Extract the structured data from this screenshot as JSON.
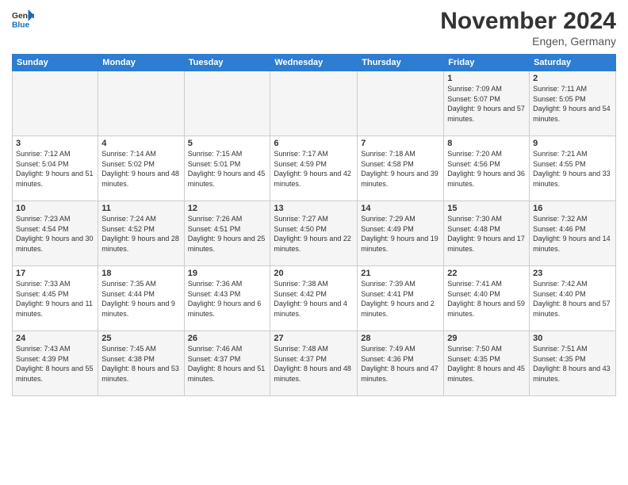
{
  "logo": {
    "general": "General",
    "blue": "Blue"
  },
  "header": {
    "title": "November 2024",
    "location": "Engen, Germany"
  },
  "days_of_week": [
    "Sunday",
    "Monday",
    "Tuesday",
    "Wednesday",
    "Thursday",
    "Friday",
    "Saturday"
  ],
  "weeks": [
    [
      {
        "day": "",
        "details": ""
      },
      {
        "day": "",
        "details": ""
      },
      {
        "day": "",
        "details": ""
      },
      {
        "day": "",
        "details": ""
      },
      {
        "day": "",
        "details": ""
      },
      {
        "day": "1",
        "details": "Sunrise: 7:09 AM\nSunset: 5:07 PM\nDaylight: 9 hours and 57 minutes."
      },
      {
        "day": "2",
        "details": "Sunrise: 7:11 AM\nSunset: 5:05 PM\nDaylight: 9 hours and 54 minutes."
      }
    ],
    [
      {
        "day": "3",
        "details": "Sunrise: 7:12 AM\nSunset: 5:04 PM\nDaylight: 9 hours and 51 minutes."
      },
      {
        "day": "4",
        "details": "Sunrise: 7:14 AM\nSunset: 5:02 PM\nDaylight: 9 hours and 48 minutes."
      },
      {
        "day": "5",
        "details": "Sunrise: 7:15 AM\nSunset: 5:01 PM\nDaylight: 9 hours and 45 minutes."
      },
      {
        "day": "6",
        "details": "Sunrise: 7:17 AM\nSunset: 4:59 PM\nDaylight: 9 hours and 42 minutes."
      },
      {
        "day": "7",
        "details": "Sunrise: 7:18 AM\nSunset: 4:58 PM\nDaylight: 9 hours and 39 minutes."
      },
      {
        "day": "8",
        "details": "Sunrise: 7:20 AM\nSunset: 4:56 PM\nDaylight: 9 hours and 36 minutes."
      },
      {
        "day": "9",
        "details": "Sunrise: 7:21 AM\nSunset: 4:55 PM\nDaylight: 9 hours and 33 minutes."
      }
    ],
    [
      {
        "day": "10",
        "details": "Sunrise: 7:23 AM\nSunset: 4:54 PM\nDaylight: 9 hours and 30 minutes."
      },
      {
        "day": "11",
        "details": "Sunrise: 7:24 AM\nSunset: 4:52 PM\nDaylight: 9 hours and 28 minutes."
      },
      {
        "day": "12",
        "details": "Sunrise: 7:26 AM\nSunset: 4:51 PM\nDaylight: 9 hours and 25 minutes."
      },
      {
        "day": "13",
        "details": "Sunrise: 7:27 AM\nSunset: 4:50 PM\nDaylight: 9 hours and 22 minutes."
      },
      {
        "day": "14",
        "details": "Sunrise: 7:29 AM\nSunset: 4:49 PM\nDaylight: 9 hours and 19 minutes."
      },
      {
        "day": "15",
        "details": "Sunrise: 7:30 AM\nSunset: 4:48 PM\nDaylight: 9 hours and 17 minutes."
      },
      {
        "day": "16",
        "details": "Sunrise: 7:32 AM\nSunset: 4:46 PM\nDaylight: 9 hours and 14 minutes."
      }
    ],
    [
      {
        "day": "17",
        "details": "Sunrise: 7:33 AM\nSunset: 4:45 PM\nDaylight: 9 hours and 11 minutes."
      },
      {
        "day": "18",
        "details": "Sunrise: 7:35 AM\nSunset: 4:44 PM\nDaylight: 9 hours and 9 minutes."
      },
      {
        "day": "19",
        "details": "Sunrise: 7:36 AM\nSunset: 4:43 PM\nDaylight: 9 hours and 6 minutes."
      },
      {
        "day": "20",
        "details": "Sunrise: 7:38 AM\nSunset: 4:42 PM\nDaylight: 9 hours and 4 minutes."
      },
      {
        "day": "21",
        "details": "Sunrise: 7:39 AM\nSunset: 4:41 PM\nDaylight: 9 hours and 2 minutes."
      },
      {
        "day": "22",
        "details": "Sunrise: 7:41 AM\nSunset: 4:40 PM\nDaylight: 8 hours and 59 minutes."
      },
      {
        "day": "23",
        "details": "Sunrise: 7:42 AM\nSunset: 4:40 PM\nDaylight: 8 hours and 57 minutes."
      }
    ],
    [
      {
        "day": "24",
        "details": "Sunrise: 7:43 AM\nSunset: 4:39 PM\nDaylight: 8 hours and 55 minutes."
      },
      {
        "day": "25",
        "details": "Sunrise: 7:45 AM\nSunset: 4:38 PM\nDaylight: 8 hours and 53 minutes."
      },
      {
        "day": "26",
        "details": "Sunrise: 7:46 AM\nSunset: 4:37 PM\nDaylight: 8 hours and 51 minutes."
      },
      {
        "day": "27",
        "details": "Sunrise: 7:48 AM\nSunset: 4:37 PM\nDaylight: 8 hours and 48 minutes."
      },
      {
        "day": "28",
        "details": "Sunrise: 7:49 AM\nSunset: 4:36 PM\nDaylight: 8 hours and 47 minutes."
      },
      {
        "day": "29",
        "details": "Sunrise: 7:50 AM\nSunset: 4:35 PM\nDaylight: 8 hours and 45 minutes."
      },
      {
        "day": "30",
        "details": "Sunrise: 7:51 AM\nSunset: 4:35 PM\nDaylight: 8 hours and 43 minutes."
      }
    ]
  ]
}
